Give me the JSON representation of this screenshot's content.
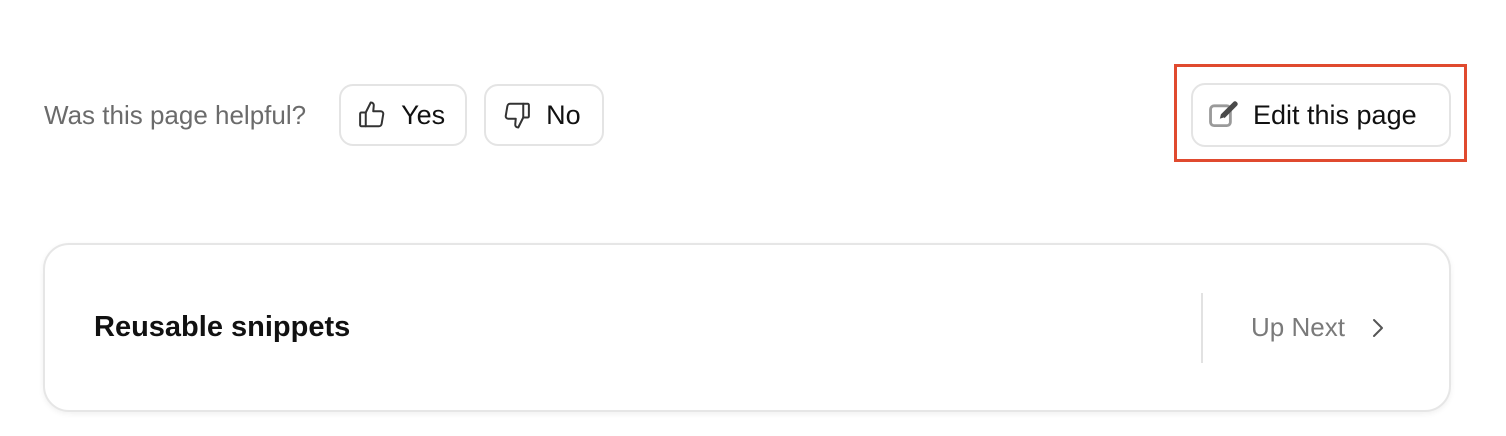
{
  "feedback": {
    "question": "Was this page helpful?",
    "yes_label": "Yes",
    "yes_icon": "thumbs-up-icon",
    "no_label": "No",
    "no_icon": "thumbs-down-icon"
  },
  "edit": {
    "label": "Edit this page",
    "icon": "pencil-square-icon",
    "highlighted": true,
    "highlight_color": "#e04a2f"
  },
  "navigation": {
    "next_title": "Reusable snippets",
    "up_next_label": "Up Next",
    "chevron_icon": "chevron-right-icon"
  },
  "colors": {
    "text_primary": "#111111",
    "text_muted": "#6b6b6b",
    "border": "#e4e4e4"
  }
}
